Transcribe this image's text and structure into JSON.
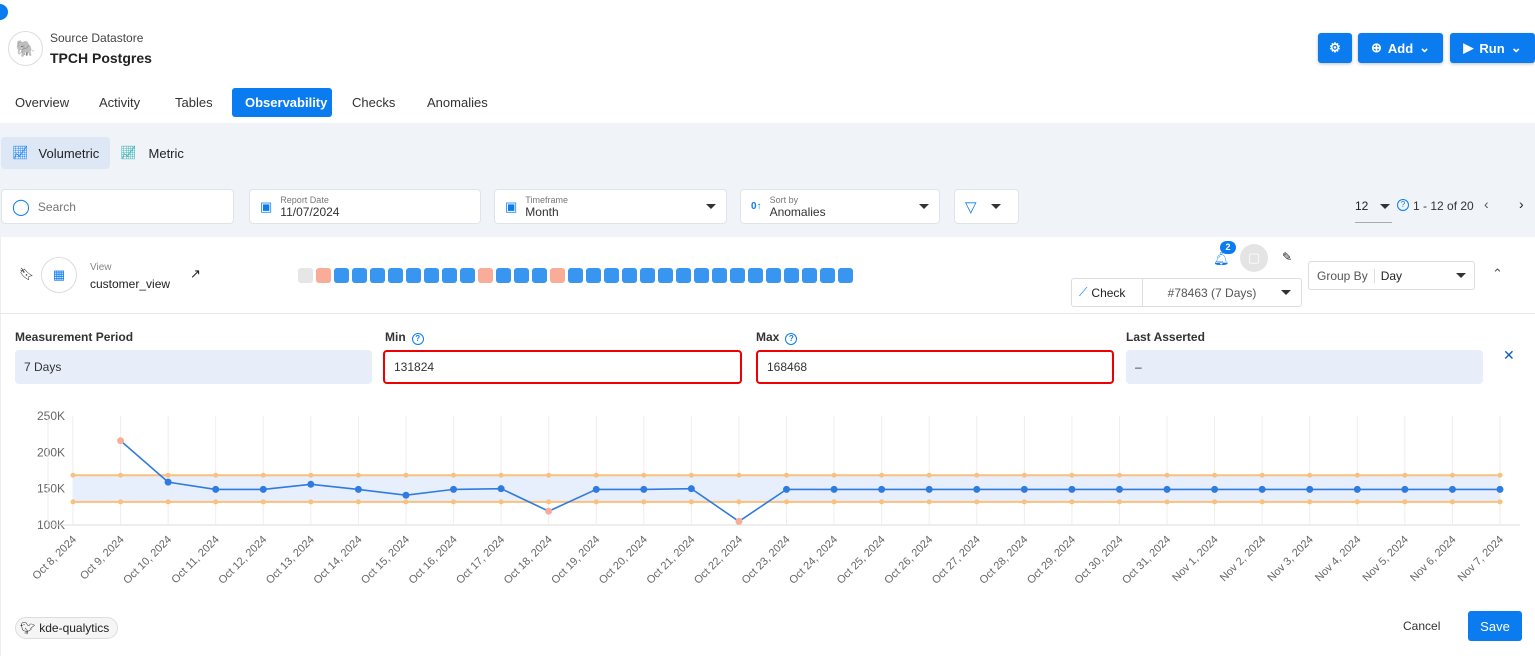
{
  "header": {
    "subtitle": "Source Datastore",
    "title": "TPCH Postgres",
    "settings_icon": "gear-icon",
    "add_label": "Add",
    "run_label": "Run"
  },
  "tabs": [
    {
      "label": "Overview"
    },
    {
      "label": "Activity"
    },
    {
      "label": "Tables"
    },
    {
      "label": "Observability",
      "active": true
    },
    {
      "label": "Checks"
    },
    {
      "label": "Anomalies"
    }
  ],
  "subtabs": [
    {
      "label": "Volumetric",
      "active": true
    },
    {
      "label": "Metric"
    }
  ],
  "filters": {
    "search_placeholder": "Search",
    "report_date_label": "Report Date",
    "report_date": "11/07/2024",
    "timeframe_label": "Timeframe",
    "timeframe": "Month",
    "sort_label": "Sort by",
    "sort": "Anomalies"
  },
  "pagination": {
    "per_page": "12",
    "range": "1 - 12 of 20"
  },
  "card": {
    "type_label": "View",
    "name": "customer_view",
    "badge_count": "2",
    "check_label": "Check",
    "check_value": "#78463 (7 Days)",
    "group_by_label": "Group By",
    "group_by": "Day",
    "statuses": [
      "none",
      "anomaly",
      "ok",
      "ok",
      "ok",
      "ok",
      "ok",
      "ok",
      "ok",
      "ok",
      "anomaly",
      "ok",
      "ok",
      "ok",
      "anomaly",
      "ok",
      "ok",
      "ok",
      "ok",
      "ok",
      "ok",
      "ok",
      "ok",
      "ok",
      "ok",
      "ok",
      "ok",
      "ok",
      "ok",
      "ok",
      "ok"
    ],
    "status_colors": {
      "none": "#e6e6e6",
      "anomaly": "#f9ad98",
      "ok": "#3896f0"
    }
  },
  "fields": {
    "period_label": "Measurement Period",
    "period": "7 Days",
    "min_label": "Min",
    "min": "131824",
    "max_label": "Max",
    "max": "168468",
    "last_label": "Last Asserted",
    "last": "–"
  },
  "footer": {
    "tag": "kde-qualytics",
    "cancel": "Cancel",
    "save": "Save"
  },
  "chart_data": {
    "type": "line",
    "ylim": [
      100000,
      250000
    ],
    "yticks": [
      "100K",
      "150K",
      "200K",
      "250K"
    ],
    "grid": true,
    "x": [
      "Oct 8, 2024",
      "Oct 9, 2024",
      "Oct 10, 2024",
      "Oct 11, 2024",
      "Oct 12, 2024",
      "Oct 13, 2024",
      "Oct 14, 2024",
      "Oct 15, 2024",
      "Oct 16, 2024",
      "Oct 17, 2024",
      "Oct 18, 2024",
      "Oct 19, 2024",
      "Oct 20, 2024",
      "Oct 21, 2024",
      "Oct 22, 2024",
      "Oct 23, 2024",
      "Oct 24, 2024",
      "Oct 25, 2024",
      "Oct 26, 2024",
      "Oct 27, 2024",
      "Oct 28, 2024",
      "Oct 29, 2024",
      "Oct 30, 2024",
      "Oct 31, 2024",
      "Nov 1, 2024",
      "Nov 2, 2024",
      "Nov 3, 2024",
      "Nov 4, 2024",
      "Nov 5, 2024",
      "Nov 6, 2024",
      "Nov 7, 2024"
    ],
    "values": [
      null,
      216000,
      159000,
      149000,
      149000,
      156000,
      149000,
      141000,
      149000,
      150000,
      119000,
      149000,
      149000,
      150000,
      105000,
      149000,
      149000,
      149000,
      149000,
      149000,
      149000,
      149000,
      149000,
      149000,
      149000,
      149000,
      149000,
      149000,
      149000,
      149000,
      149000
    ],
    "anomalies": [
      1,
      10,
      14
    ],
    "band_min": 131824,
    "band_max": 168468,
    "colors": {
      "line": "#2f7be0",
      "band": "#f9c07e",
      "band_fill": "#e8effc",
      "anomaly": "#f9ad98"
    }
  }
}
